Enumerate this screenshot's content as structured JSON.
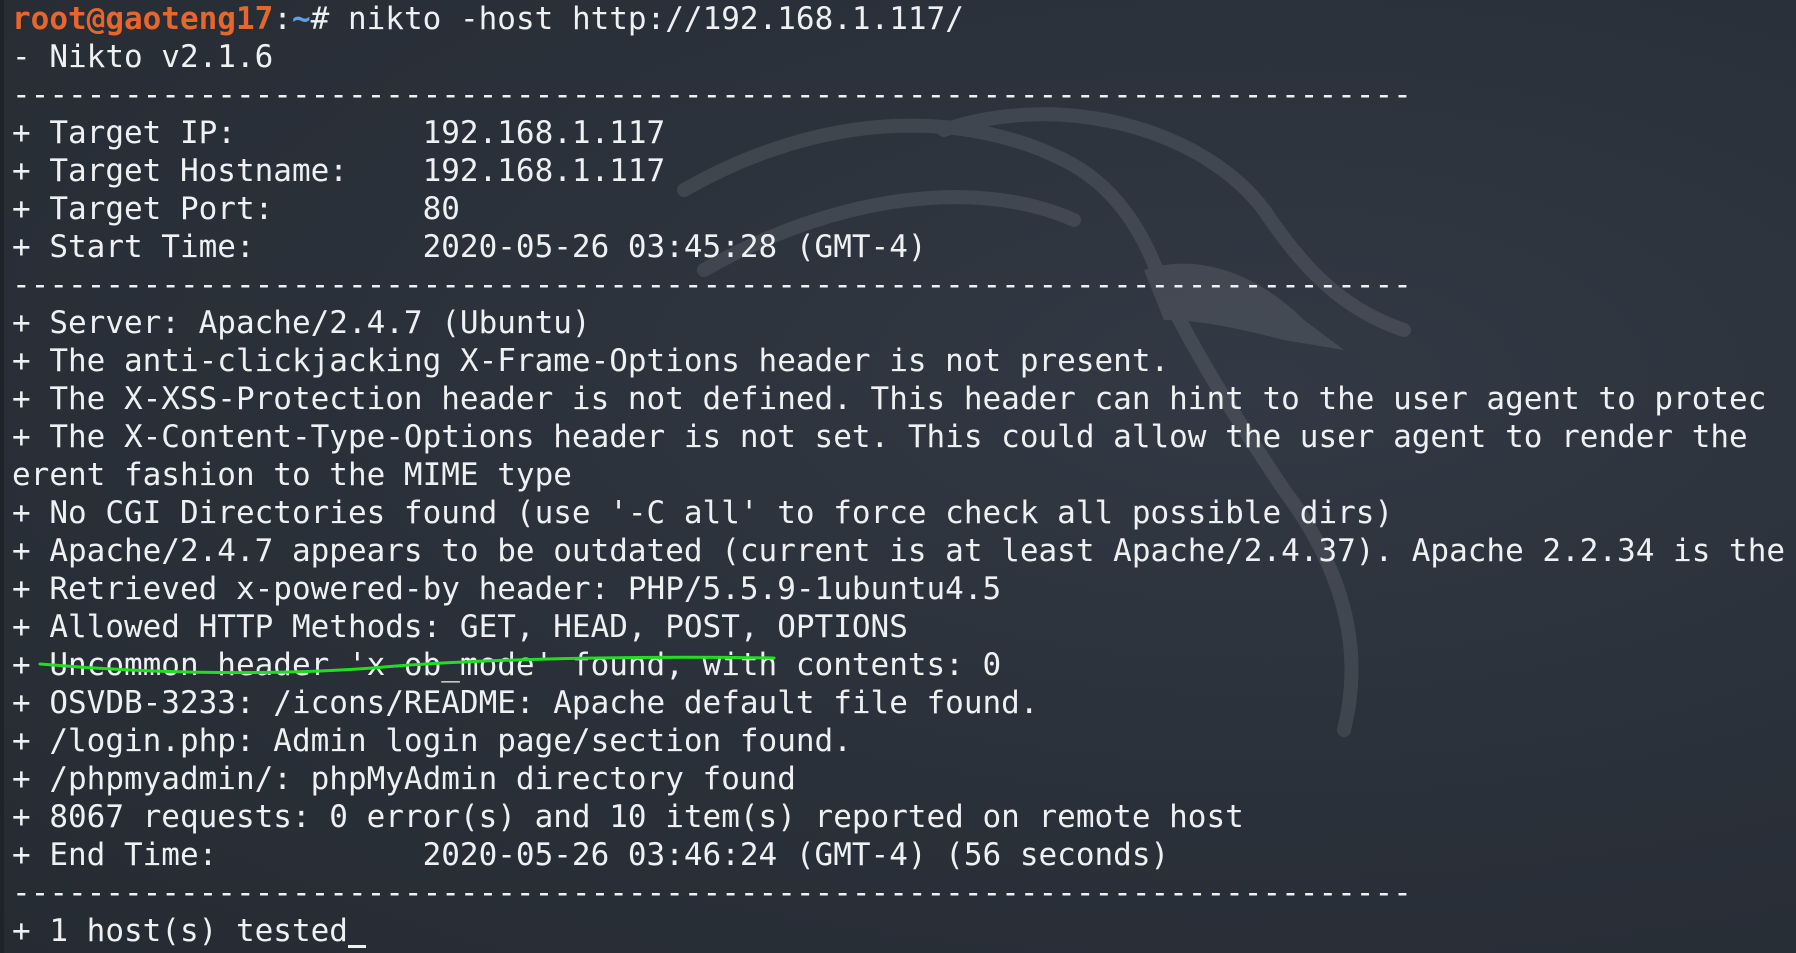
{
  "prompt": {
    "user_host": "root@gaoteng17",
    "separator": ":",
    "path": "~",
    "symbol": "#",
    "command": " nikto -host http://192.168.1.117/"
  },
  "output_lines": [
    "- Nikto v2.1.6",
    "---------------------------------------------------------------------------",
    "+ Target IP:          192.168.1.117",
    "+ Target Hostname:    192.168.1.117",
    "+ Target Port:        80",
    "+ Start Time:         2020-05-26 03:45:28 (GMT-4)",
    "---------------------------------------------------------------------------",
    "+ Server: Apache/2.4.7 (Ubuntu)",
    "+ The anti-clickjacking X-Frame-Options header is not present.",
    "+ The X-XSS-Protection header is not defined. This header can hint to the user agent to protec",
    "+ The X-Content-Type-Options header is not set. This could allow the user agent to render the ",
    "erent fashion to the MIME type",
    "+ No CGI Directories found (use '-C all' to force check all possible dirs)",
    "+ Apache/2.4.7 appears to be outdated (current is at least Apache/2.4.37). Apache 2.2.34 is the",
    "+ Retrieved x-powered-by header: PHP/5.5.9-1ubuntu4.5",
    "+ Allowed HTTP Methods: GET, HEAD, POST, OPTIONS",
    "+ Uncommon header 'x-ob_mode' found, with contents: 0",
    "+ OSVDB-3233: /icons/README: Apache default file found.",
    "+ /login.php: Admin login page/section found.",
    "+ /phpmyadmin/: phpMyAdmin directory found",
    "+ 8067 requests: 0 error(s) and 10 item(s) reported on remote host",
    "+ End Time:           2020-05-26 03:46:24 (GMT-4) (56 seconds)",
    "---------------------------------------------------------------------------",
    "+ 1 host(s) tested"
  ],
  "colors": {
    "background": "#2b313a",
    "text": "#eef0f2",
    "prompt_user": "#e8652b",
    "prompt_path": "#5ea0e8",
    "annotation_underline": "#22dd22"
  },
  "icons": {
    "watermark": "kali-dragon-icon"
  }
}
